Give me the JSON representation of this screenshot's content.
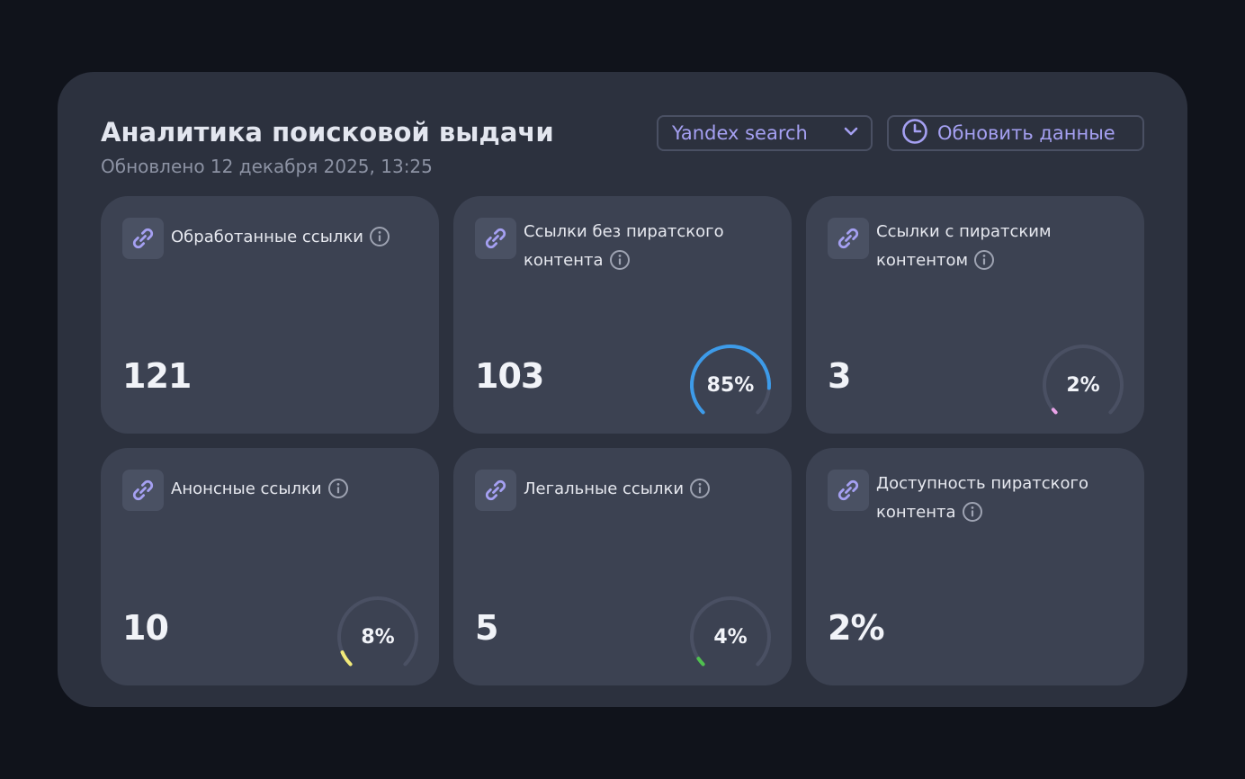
{
  "header": {
    "title": "Аналитика поисковой выдачи",
    "updated": "Обновлено 12 декабря 2025, 13:25",
    "search_select": "Yandex search",
    "refresh_label": "Обновить данные"
  },
  "icons": {
    "card_icon": "link-icon",
    "info_icon": "info-icon",
    "select_icon": "chevron-down-icon",
    "refresh_icon": "clock-icon"
  },
  "colors": {
    "accent": "#a5a0f2",
    "gauge_track": "#4a5063",
    "gauge_blue": "#3d9be9",
    "gauge_pink": "#e9a3e8",
    "gauge_yellow": "#f2ea7a",
    "gauge_green": "#4fc04f"
  },
  "cards": [
    {
      "label": "Обработанные ссылки",
      "value": "121"
    },
    {
      "label": "Ссылки без пиратского контента",
      "value": "103",
      "percent_label": "85%",
      "percent": 0.85,
      "color": "#3d9be9"
    },
    {
      "label": "Ссылки с пиратским контентом",
      "value": "3",
      "percent_label": "2%",
      "percent": 0.02,
      "color": "#e9a3e8"
    },
    {
      "label": "Анонсные ссылки",
      "value": "10",
      "percent_label": "8%",
      "percent": 0.08,
      "color": "#f2ea7a"
    },
    {
      "label": "Легальные ссылки",
      "value": "5",
      "percent_label": "4%",
      "percent": 0.04,
      "color": "#4fc04f"
    },
    {
      "label": "Доступность пиратского контента",
      "value": "2%"
    }
  ]
}
